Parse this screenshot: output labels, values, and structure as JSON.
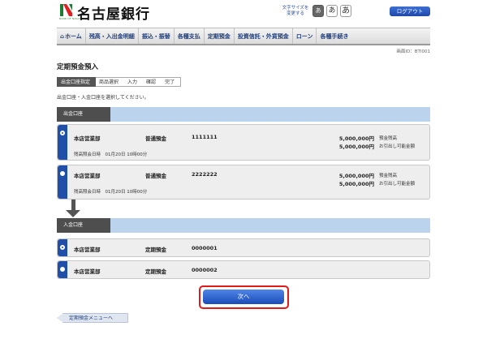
{
  "header": {
    "logo_text": "名古屋銀行",
    "logo_sub": "BANK OF NAGOYA",
    "font_size_label": "文字サイズを\n変更する",
    "font_sizes": [
      "あ",
      "あ",
      "あ"
    ],
    "logout_label": "ログアウト"
  },
  "nav": {
    "items": [
      "ホーム",
      "残高・入出金明細",
      "振込・振替",
      "各種支払",
      "定期預金",
      "投資信託・外貨預金",
      "ローン",
      "各種手続き"
    ]
  },
  "screen_id": "画面ID：BTI001",
  "page_title": "定期預金預入",
  "steps": [
    "出金口座指定",
    "商品選択",
    "入力",
    "確認",
    "完了"
  ],
  "instruction": "出金口座・入金口座を選択してください。",
  "withdraw_section": {
    "label": "出金口座",
    "accounts": [
      {
        "branch": "本店営業部",
        "type": "普通預金",
        "number": "1111111",
        "balance": "5,000,000円",
        "balance_label": "預金残高",
        "available": "5,000,000円",
        "available_label": "お引出し可能金額",
        "timestamp": "残高照会日時　01月20日 10時00分",
        "checked": true
      },
      {
        "branch": "本店営業部",
        "type": "普通預金",
        "number": "2222222",
        "balance": "5,000,000円",
        "balance_label": "預金残高",
        "available": "5,000,000円",
        "available_label": "お引出し可能金額",
        "timestamp": "残高照会日時　01月20日 10時00分",
        "checked": false
      }
    ]
  },
  "deposit_section": {
    "label": "入金口座",
    "accounts": [
      {
        "branch": "本店営業部",
        "type": "定期預金",
        "number": "0000001",
        "checked": true
      },
      {
        "branch": "本店営業部",
        "type": "定期預金",
        "number": "0000002",
        "checked": false
      }
    ]
  },
  "next_label": "次へ",
  "back_label": "定期預金メニューへ",
  "colors": {
    "accent_blue": "#1f4fa8",
    "highlight_red": "#e21a1a",
    "section_bar": "#bcd3ee"
  }
}
